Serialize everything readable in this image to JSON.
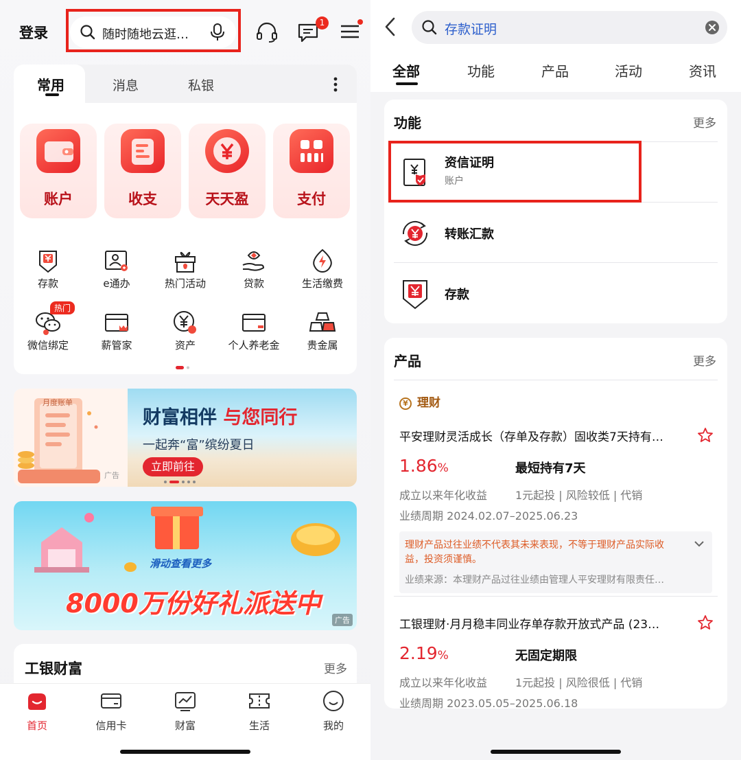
{
  "left": {
    "header": {
      "login_label": "登录",
      "search_placeholder": "随时随地云逛…",
      "message_badge": "1"
    },
    "tabs": [
      {
        "label": "常用"
      },
      {
        "label": "消息"
      },
      {
        "label": "私银"
      }
    ],
    "big_tiles": [
      {
        "label": "账户"
      },
      {
        "label": "收支"
      },
      {
        "label": "天天盈"
      },
      {
        "label": "支付"
      }
    ],
    "grid_row1": [
      {
        "label": "存款"
      },
      {
        "label": "e通办"
      },
      {
        "label": "热门活动"
      },
      {
        "label": "贷款"
      },
      {
        "label": "生活缴费"
      }
    ],
    "grid_row2": [
      {
        "label": "微信绑定"
      },
      {
        "label": "薪管家"
      },
      {
        "label": "资产"
      },
      {
        "label": "个人养老金"
      },
      {
        "label": "贵金属"
      }
    ],
    "hot_badge": "热门",
    "banner1": {
      "title_a": "财富相伴",
      "title_b": "与您同行",
      "subtitle": "一起奔“富”缤纷夏日",
      "button": "立即前往",
      "ad": "广告",
      "bill_label": "月度账单"
    },
    "banner2": {
      "hint": "滑动查看更多",
      "headline": "8000万份好礼派送中",
      "ad": "广告"
    },
    "wealth": {
      "title": "工银财富",
      "more": "更多"
    },
    "bottom_nav": [
      {
        "label": "首页"
      },
      {
        "label": "信用卡"
      },
      {
        "label": "财富"
      },
      {
        "label": "生活"
      },
      {
        "label": "我的"
      }
    ]
  },
  "right": {
    "search": {
      "query": "存款证明"
    },
    "tabs": [
      {
        "label": "全部"
      },
      {
        "label": "功能"
      },
      {
        "label": "产品"
      },
      {
        "label": "活动"
      },
      {
        "label": "资讯"
      }
    ],
    "functions": {
      "title": "功能",
      "more": "更多",
      "items": [
        {
          "title": "资信证明",
          "subtitle": "账户"
        },
        {
          "title": "转账汇款"
        },
        {
          "title": "存款"
        }
      ]
    },
    "products": {
      "title": "产品",
      "more": "更多",
      "category": "理财",
      "items": [
        {
          "name": "平安理财灵活成长（存单及存款）固收类7天持有…",
          "rate": "1.86",
          "rate_unit": "%",
          "term": "最短持有7天",
          "rate_label": "成立以来年化收益",
          "attrs": "1元起投 | 风险较低 | 代销",
          "period": "业绩周期  2024.02.07–2025.06.23",
          "warning": "理财产品过往业绩不代表其未来表现，不等于理财产品实际收益，投资须谨慎。",
          "source": "业绩来源：本理财产品过往业绩由管理人平安理财有限责任…"
        },
        {
          "name": "工银理财·月月稳丰同业存单存款开放式产品 (23…",
          "rate": "2.19",
          "rate_unit": "%",
          "term": "无固定期限",
          "rate_label": "成立以来年化收益",
          "attrs": "1元起投 | 风险很低 | 代销",
          "period": "业绩周期  2023.05.05–2025.06.18"
        }
      ]
    }
  },
  "colors": {
    "brand_red": "#e3262f",
    "highlight_frame": "#e8231c",
    "link_blue": "#2d5fcc",
    "warning_orange": "#dd5a24"
  }
}
